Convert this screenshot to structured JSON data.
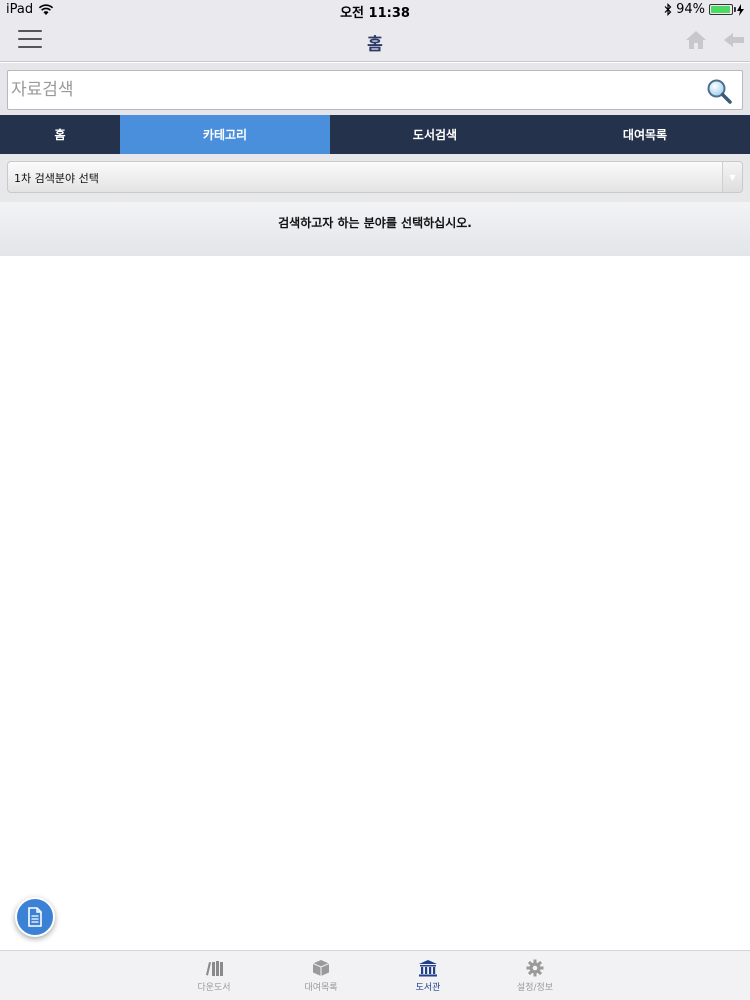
{
  "status_bar": {
    "device": "iPad",
    "time": "오전 11:38",
    "battery": "94%",
    "battery_level": 0.94
  },
  "nav": {
    "title": "홈"
  },
  "search": {
    "placeholder": "자료검색",
    "value": ""
  },
  "tabs": [
    {
      "label": "홈"
    },
    {
      "label": "카테고리"
    },
    {
      "label": "도서검색"
    },
    {
      "label": "대여목록"
    }
  ],
  "category_select": {
    "label": "1차 검색분야 선택"
  },
  "message": "검색하고자 하는 분야를 선택하십시오.",
  "bottom_tabs": [
    {
      "label": "다운도서",
      "icon": "books-icon"
    },
    {
      "label": "대여목록",
      "icon": "box-icon"
    },
    {
      "label": "도서관",
      "icon": "library-icon"
    },
    {
      "label": "설정/정보",
      "icon": "gear-icon"
    }
  ],
  "colors": {
    "tab_bar": "#25324b",
    "tab_active": "#4a8fdc",
    "nav_title": "#2b3a67",
    "fab": "#3b82d6",
    "bottom_active": "#1f3f8c"
  }
}
